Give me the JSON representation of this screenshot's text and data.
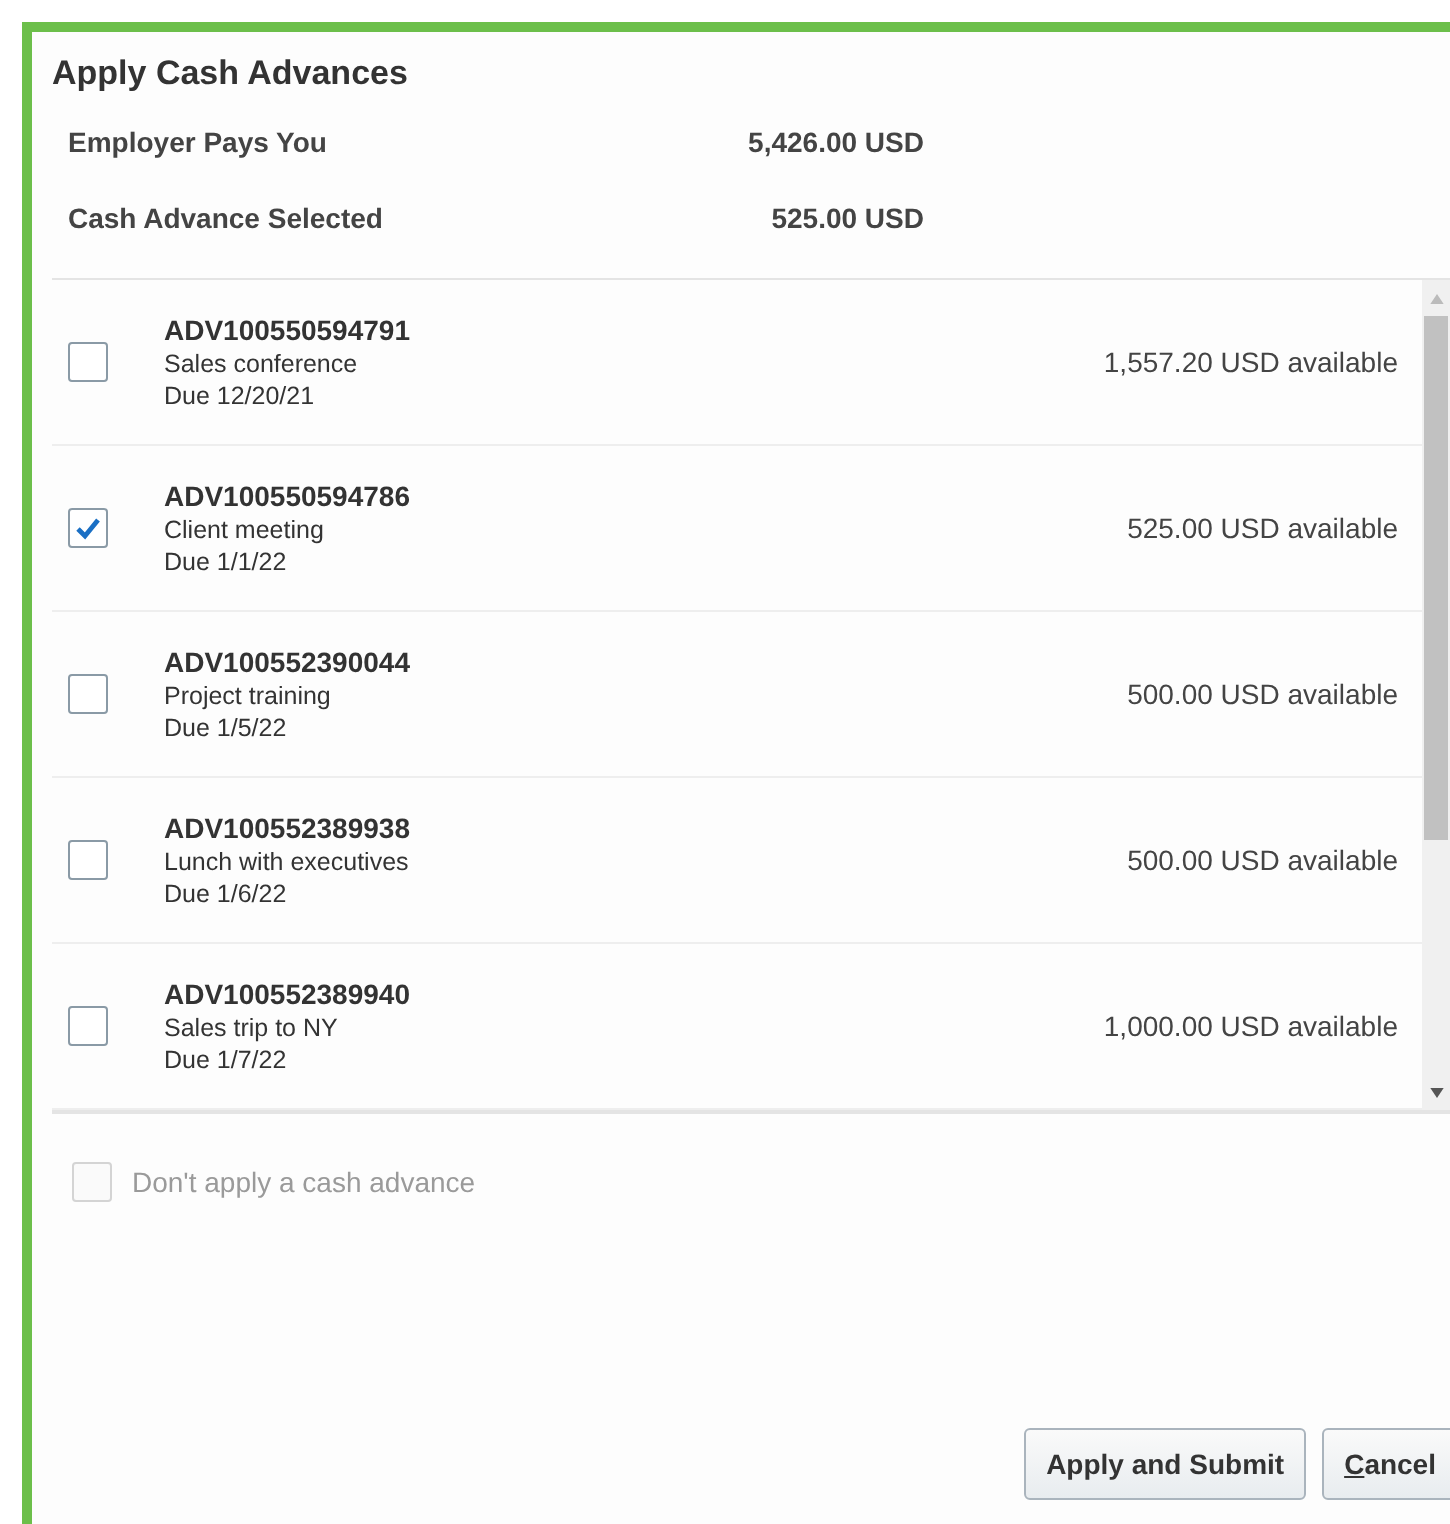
{
  "dialog": {
    "title": "Apply Cash Advances"
  },
  "summary": [
    {
      "label": "Employer Pays You",
      "value": "5,426.00 USD"
    },
    {
      "label": "Cash Advance Selected",
      "value": "525.00 USD"
    }
  ],
  "advances": [
    {
      "id": "ADV100550594791",
      "purpose": "Sales conference",
      "due": "Due 12/20/21",
      "available": "1,557.20 USD available",
      "checked": false
    },
    {
      "id": "ADV100550594786",
      "purpose": "Client meeting",
      "due": "Due 1/1/22",
      "available": "525.00 USD available",
      "checked": true
    },
    {
      "id": "ADV100552390044",
      "purpose": "Project training",
      "due": "Due 1/5/22",
      "available": "500.00 USD available",
      "checked": false
    },
    {
      "id": "ADV100552389938",
      "purpose": "Lunch with executives",
      "due": "Due 1/6/22",
      "available": "500.00 USD available",
      "checked": false
    },
    {
      "id": "ADV100552389940",
      "purpose": "Sales trip to NY",
      "due": "Due 1/7/22",
      "available": "1,000.00 USD available",
      "checked": false
    }
  ],
  "no_advance": {
    "label": "Don't apply a cash advance",
    "checked": false,
    "disabled": true
  },
  "buttons": [
    {
      "label": "Apply and Submit",
      "kind": "plain"
    },
    {
      "label": "Cancel",
      "kind": "access"
    }
  ]
}
